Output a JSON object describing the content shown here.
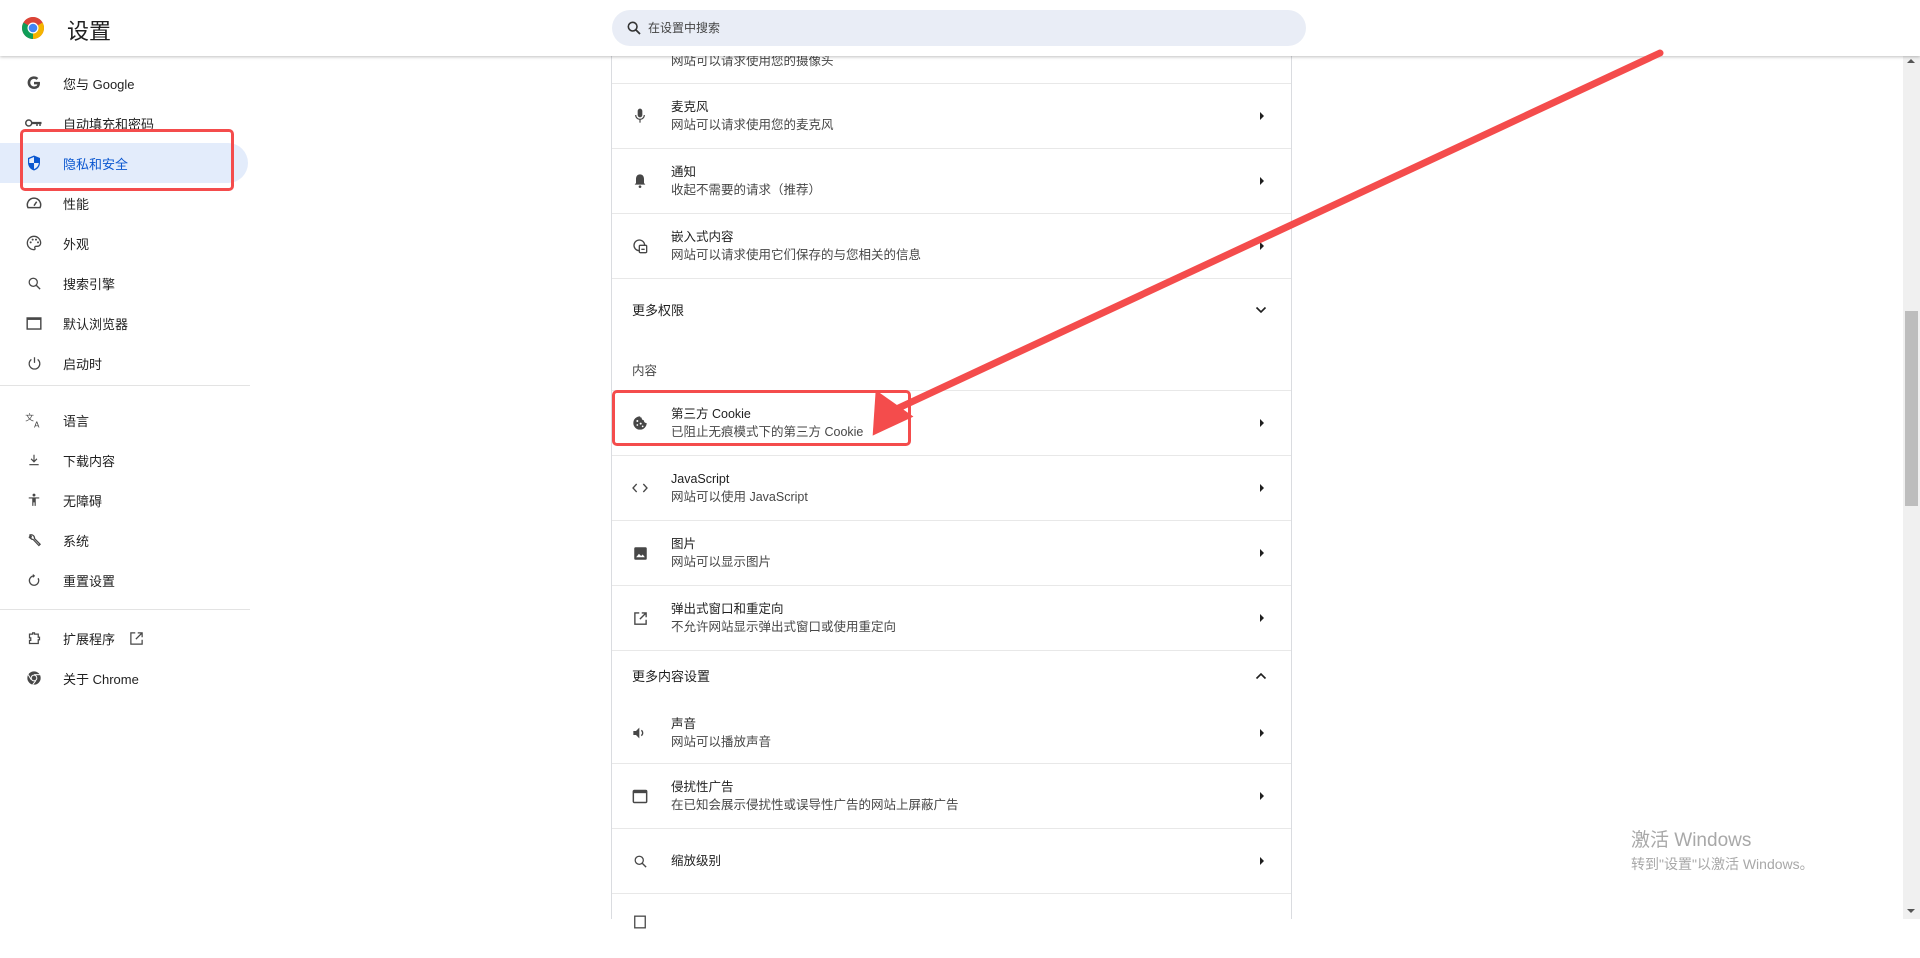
{
  "header": {
    "title": "设置",
    "logo_icon": "chrome-logo-icon",
    "search_placeholder": "在设置中搜索"
  },
  "sidebar": {
    "items": [
      {
        "label": "您与 Google",
        "icon": "google-g-icon"
      },
      {
        "label": "自动填充和密码",
        "icon": "key-icon"
      },
      {
        "label": "隐私和安全",
        "icon": "shield-icon",
        "active": true
      },
      {
        "label": "性能",
        "icon": "speedometer-icon"
      },
      {
        "label": "外观",
        "icon": "palette-icon"
      },
      {
        "label": "搜索引擎",
        "icon": "search-icon"
      },
      {
        "label": "默认浏览器",
        "icon": "browser-window-icon"
      },
      {
        "label": "启动时",
        "icon": "power-icon"
      },
      {
        "label": "语言",
        "icon": "translate-icon"
      },
      {
        "label": "下载内容",
        "icon": "download-icon"
      },
      {
        "label": "无障碍",
        "icon": "accessibility-icon"
      },
      {
        "label": "系统",
        "icon": "wrench-icon"
      },
      {
        "label": "重置设置",
        "icon": "reset-icon"
      },
      {
        "label": "扩展程序",
        "icon": "extension-icon"
      },
      {
        "label": "关于 Chrome",
        "icon": "chrome-icon"
      }
    ]
  },
  "content": {
    "camera_subtitle": "网站可以请求使用您的摄像头",
    "permission_rows": [
      {
        "title": "麦克风",
        "subtitle": "网站可以请求使用您的麦克风",
        "icon": "microphone-icon"
      },
      {
        "title": "通知",
        "subtitle": "收起不需要的请求（推荐）",
        "icon": "bell-icon"
      },
      {
        "title": "嵌入式内容",
        "subtitle": "网站可以请求使用它们保存的与您相关的信息",
        "icon": "embedded-content-icon"
      }
    ],
    "more_permissions_label": "更多权限",
    "content_section_title": "内容",
    "content_rows": [
      {
        "title": "第三方 Cookie",
        "subtitle": "已阻止无痕模式下的第三方 Cookie",
        "icon": "cookie-icon"
      },
      {
        "title": "JavaScript",
        "subtitle": "网站可以使用 JavaScript",
        "icon": "code-icon"
      },
      {
        "title": "图片",
        "subtitle": "网站可以显示图片",
        "icon": "image-icon"
      },
      {
        "title": "弹出式窗口和重定向",
        "subtitle": "不允许网站显示弹出式窗口或使用重定向",
        "icon": "open-in-new-icon"
      }
    ],
    "more_content_label": "更多内容设置",
    "more_content_rows": [
      {
        "title": "声音",
        "subtitle": "网站可以播放声音",
        "icon": "speaker-icon"
      },
      {
        "title": "侵扰性广告",
        "subtitle": "在已知会展示侵扰性或误导性广告的网站上屏蔽广告",
        "icon": "ads-window-icon"
      },
      {
        "title": "缩放级别",
        "subtitle": "",
        "icon": "zoom-icon"
      }
    ]
  },
  "watermark": {
    "line1": "激活 Windows",
    "line2": "转到\"设置\"以激活 Windows。"
  },
  "annotation": {
    "color": "#f44c4c"
  },
  "colors": {
    "accent": "#0b57d0",
    "active_bg": "#e3ecfb",
    "search_bg": "#e9edf6"
  }
}
